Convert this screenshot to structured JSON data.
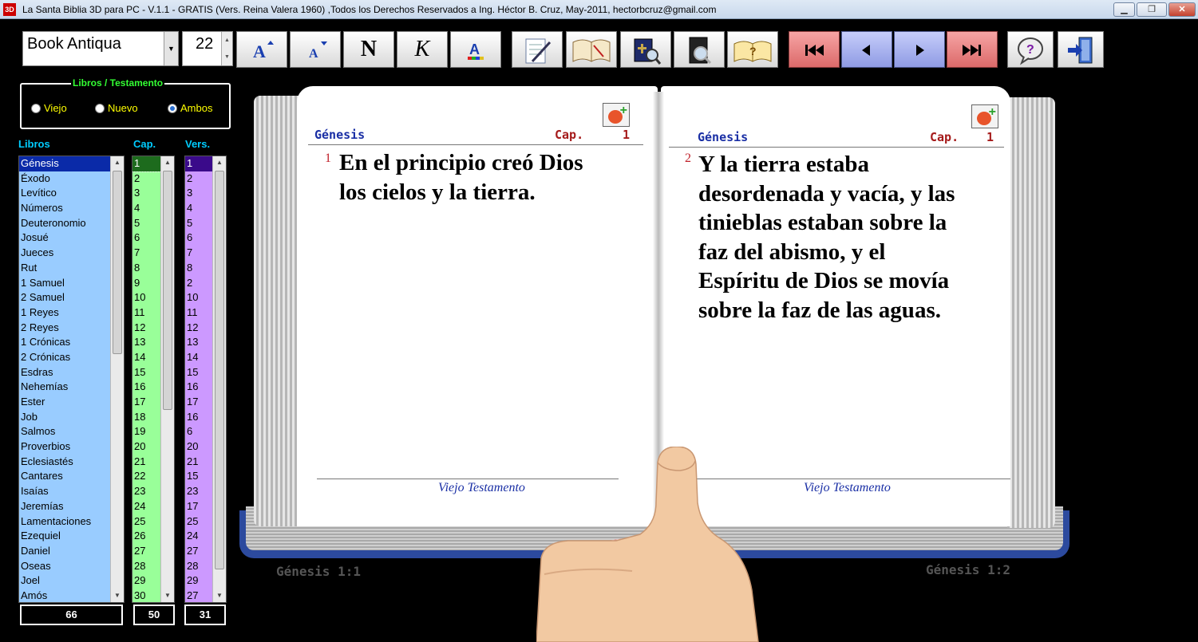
{
  "window": {
    "title": "La Santa Biblia 3D para PC - V.1.1 - GRATIS (Vers. Reina Valera 1960) ,Todos los Derechos Reservados  a Ing. Héctor B. Cruz, May-2011, hectorbcruz@gmail.com",
    "app_icon_text": "3D",
    "minimize": "▁",
    "maximize": "❐",
    "close": "✕"
  },
  "toolbar": {
    "font_name": "Book Antiqua",
    "font_size": "22",
    "bold_label": "N",
    "italic_label": "K",
    "icons": [
      "font-increase-icon",
      "font-decrease-icon",
      "bold-icon",
      "italic-icon",
      "font-color-icon",
      "notes-icon",
      "reading-book-icon",
      "search-bible-icon",
      "search-page-icon",
      "open-book-icon",
      "first-icon",
      "prev-icon",
      "next-icon",
      "last-icon",
      "help-icon",
      "exit-icon"
    ]
  },
  "testament": {
    "legend": "Libros / Testamento",
    "options": [
      "Viejo",
      "Nuevo",
      "Ambos"
    ],
    "selected": "Ambos"
  },
  "columns": {
    "books": "Libros",
    "chapters": "Cap.",
    "verses": "Vers."
  },
  "books": [
    "Génesis",
    "Éxodo",
    "Levítico",
    "Números",
    "Deuteronomio",
    "Josué",
    "Jueces",
    "Rut",
    "1 Samuel",
    "2 Samuel",
    "1 Reyes",
    "2 Reyes",
    "1 Crónicas",
    "2 Crónicas",
    "Esdras",
    "Nehemías",
    "Ester",
    "Job",
    "Salmos",
    "Proverbios",
    "Eclesiastés",
    "Cantares",
    "Isaías",
    "Jeremías",
    "Lamentaciones",
    "Ezequiel",
    "Daniel",
    "Oseas",
    "Joel",
    "Amós"
  ],
  "chapters": [
    "1",
    "2",
    "3",
    "4",
    "5",
    "6",
    "7",
    "8",
    "9",
    "10",
    "11",
    "12",
    "13",
    "14",
    "15",
    "16",
    "17",
    "18",
    "19",
    "20",
    "21",
    "22",
    "23",
    "24",
    "25",
    "26",
    "27",
    "28",
    "29",
    "30"
  ],
  "verses": [
    "1",
    "2",
    "3",
    "4",
    "5",
    "6",
    "7",
    "8",
    "2",
    "10",
    "11",
    "12",
    "13",
    "14",
    "15",
    "16",
    "17",
    "16",
    "6",
    "20",
    "21",
    "15",
    "23",
    "17",
    "25",
    "24",
    "27",
    "28",
    "29",
    "27"
  ],
  "counts": {
    "books": "66",
    "chapters": "50",
    "verses": "31"
  },
  "left_page": {
    "book": "Génesis",
    "cap_label": "Cap.",
    "cap_num": "1",
    "verse_num": "1",
    "verse_lines": [
      "En el principio creó Dios",
      "los cielos y la tierra."
    ],
    "footer": "Viejo Testamento",
    "ref": "Génesis 1:1"
  },
  "right_page": {
    "book": "Génesis",
    "cap_label": "Cap.",
    "cap_num": "1",
    "verse_num": "2",
    "verse_lines": [
      "Y la tierra estaba",
      "desordenada y vacía, y las",
      "tinieblas estaban sobre la",
      "faz del abismo, y el",
      "Espíritu de Dios se movía",
      "sobre la faz de las aguas."
    ],
    "footer": "Viejo Testamento",
    "ref": "Génesis 1:2"
  },
  "colors": {
    "background": "#000000",
    "books_list": "#99ccff",
    "chapters_list": "#99ff99",
    "verses_list": "#cc99ff",
    "book_title": "#1a2fa5",
    "cap": "#a51a1a"
  }
}
